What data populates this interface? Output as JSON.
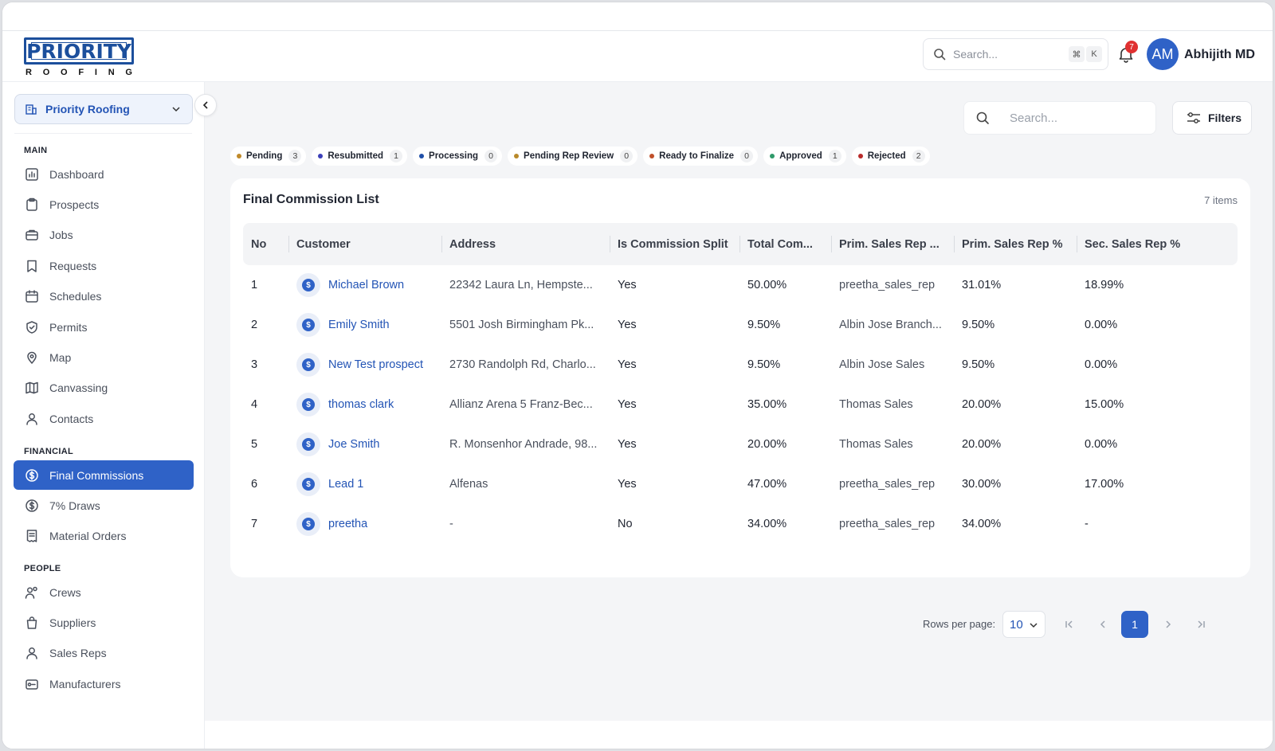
{
  "header": {
    "brand_word": "PRIORITY",
    "brand_sub": [
      "R",
      "O",
      "O",
      "F",
      "I",
      "N",
      "G"
    ],
    "search_placeholder": "Search...",
    "shortcut_keys": [
      "⌘",
      "K"
    ],
    "notification_count": "7",
    "avatar_initials": "AM",
    "user_name": "Abhijith MD"
  },
  "sidebar": {
    "org_name": "Priority Roofing",
    "sections": {
      "main": "MAIN",
      "financial": "FINANCIAL",
      "people": "PEOPLE"
    },
    "main_items": [
      "Dashboard",
      "Prospects",
      "Jobs",
      "Requests",
      "Schedules",
      "Permits",
      "Map",
      "Canvassing",
      "Contacts"
    ],
    "financial_items": [
      "Final Commissions",
      "7% Draws",
      "Material Orders"
    ],
    "people_items": [
      "Crews",
      "Suppliers",
      "Sales Reps",
      "Manufacturers"
    ],
    "active_item": "Final Commissions"
  },
  "toolbar": {
    "search_placeholder": "Search...",
    "filters_label": "Filters"
  },
  "status_chips": [
    {
      "label": "Pending",
      "count": "3",
      "color": "#c08a2a"
    },
    {
      "label": "Resubmitted",
      "count": "1",
      "color": "#3b3fb8"
    },
    {
      "label": "Processing",
      "count": "0",
      "color": "#1f4fa8"
    },
    {
      "label": "Pending Rep Review",
      "count": "0",
      "color": "#b8892a"
    },
    {
      "label": "Ready to Finalize",
      "count": "0",
      "color": "#c0502a"
    },
    {
      "label": "Approved",
      "count": "1",
      "color": "#2f9a6a"
    },
    {
      "label": "Rejected",
      "count": "2",
      "color": "#b82a2a"
    }
  ],
  "list": {
    "title": "Final Commission List",
    "count_label": "7 items",
    "columns": [
      "No",
      "Customer",
      "Address",
      "Is Commission Split",
      "Total Com...",
      "Prim. Sales Rep ...",
      "Prim. Sales Rep %",
      "Sec. Sales Rep %"
    ],
    "rows": [
      {
        "no": "1",
        "customer": "Michael Brown",
        "address": "22342 Laura Ln, Hempste...",
        "split": "Yes",
        "total": "50.00%",
        "prim_rep": "preetha_sales_rep",
        "prim_pct": "31.01%",
        "sec_pct": "18.99%"
      },
      {
        "no": "2",
        "customer": "Emily Smith",
        "address": "5501 Josh Birmingham Pk...",
        "split": "Yes",
        "total": "9.50%",
        "prim_rep": "Albin Jose Branch...",
        "prim_pct": "9.50%",
        "sec_pct": "0.00%"
      },
      {
        "no": "3",
        "customer": "New Test prospect",
        "address": "2730 Randolph Rd, Charlo...",
        "split": "Yes",
        "total": "9.50%",
        "prim_rep": "Albin Jose Sales",
        "prim_pct": "9.50%",
        "sec_pct": "0.00%"
      },
      {
        "no": "4",
        "customer": "thomas clark",
        "address": "Allianz Arena 5 Franz-Bec...",
        "split": "Yes",
        "total": "35.00%",
        "prim_rep": "Thomas Sales",
        "prim_pct": "20.00%",
        "sec_pct": "15.00%"
      },
      {
        "no": "5",
        "customer": "Joe Smith",
        "address": "R. Monsenhor Andrade, 98...",
        "split": "Yes",
        "total": "20.00%",
        "prim_rep": "Thomas Sales",
        "prim_pct": "20.00%",
        "sec_pct": "0.00%"
      },
      {
        "no": "6",
        "customer": "Lead 1",
        "address": "Alfenas",
        "split": "Yes",
        "total": "47.00%",
        "prim_rep": "preetha_sales_rep",
        "prim_pct": "30.00%",
        "sec_pct": "17.00%"
      },
      {
        "no": "7",
        "customer": "preetha",
        "address": "-",
        "split": "No",
        "total": "34.00%",
        "prim_rep": "preetha_sales_rep",
        "prim_pct": "34.00%",
        "sec_pct": "-"
      }
    ]
  },
  "pagination": {
    "rows_per_page_label": "Rows per page:",
    "rows_per_page_value": "10",
    "current_page": "1"
  },
  "colors": {
    "accent": "#2f62c7",
    "link": "#2354b5"
  }
}
